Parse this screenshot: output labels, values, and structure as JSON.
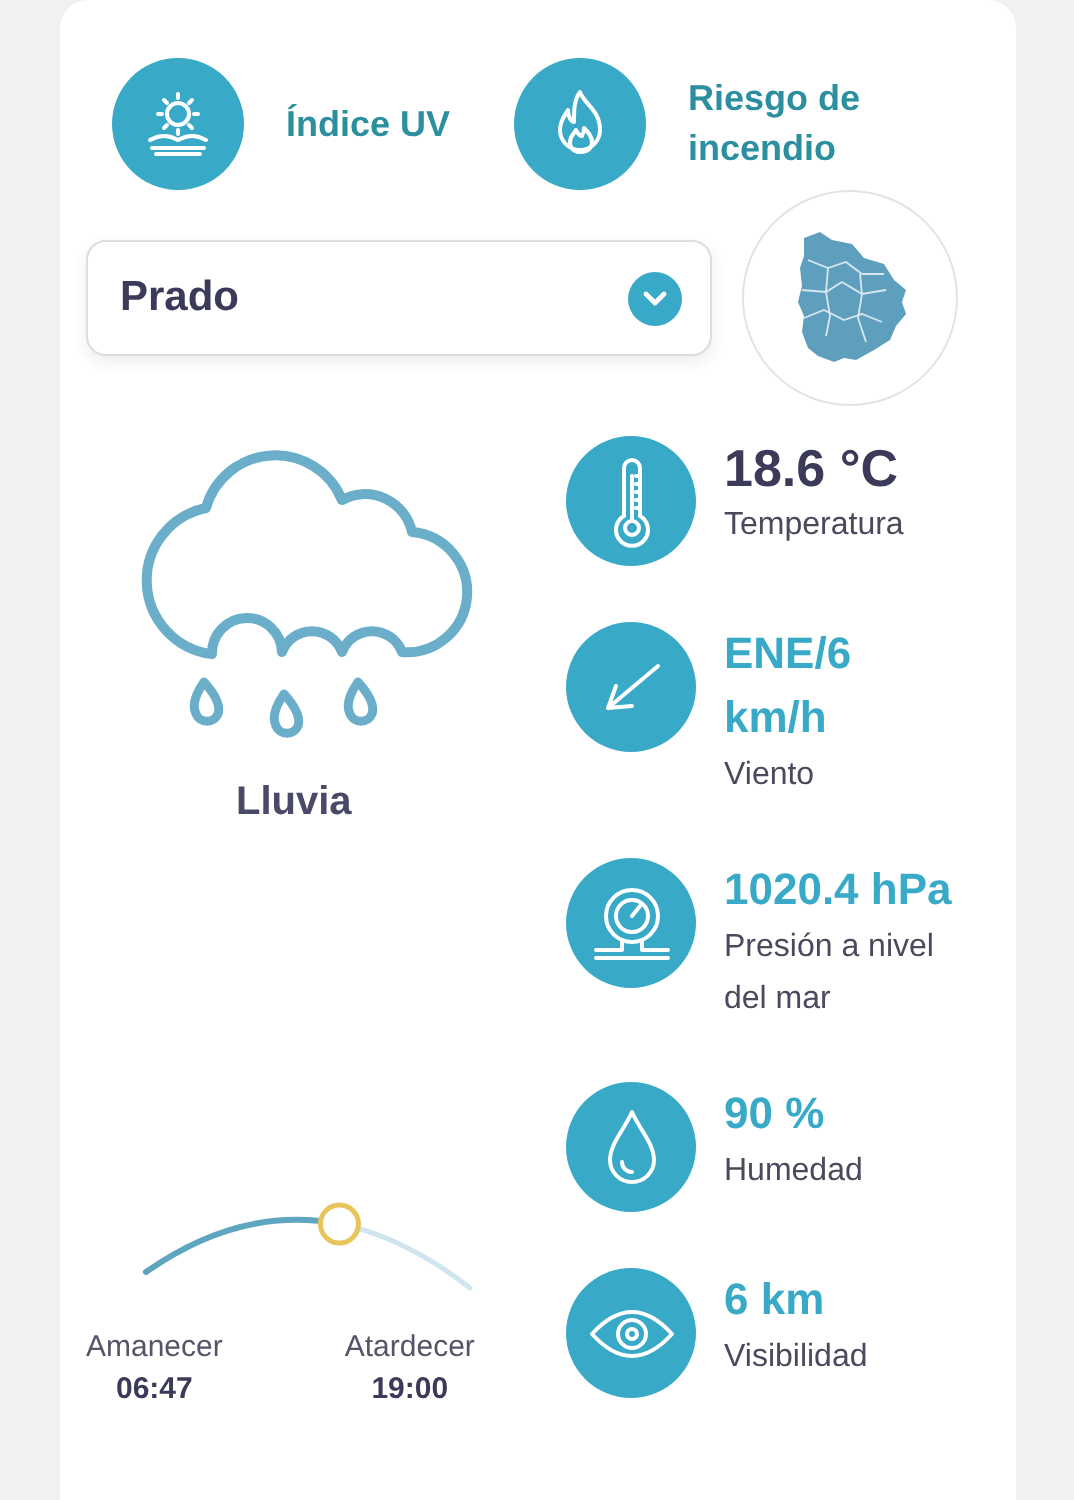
{
  "quick_links": [
    {
      "kind": "uv",
      "label": "Índice UV"
    },
    {
      "kind": "fire",
      "label": "Riesgo de incendio"
    }
  ],
  "location": {
    "value": "Prado"
  },
  "current": {
    "condition": "Lluvia"
  },
  "sun": {
    "level": 0.6,
    "sunrise_label": "Amanecer",
    "sunrise": "06:47",
    "sunset_label": "Atardecer",
    "sunset": "19:00"
  },
  "metrics": [
    {
      "kind": "temperature",
      "value": "18.6 °C",
      "label": "Temperatura",
      "color": "#3b3a58",
      "wrap": false
    },
    {
      "kind": "wind",
      "value": "ENE/6 km/h",
      "label": "Viento",
      "color": "#38a9c6",
      "wrap": true
    },
    {
      "kind": "pressure",
      "value": "1020.4 hPa",
      "label": "Presión a nivel del mar",
      "color": "#38a9c6",
      "wrap": false
    },
    {
      "kind": "humidity",
      "value": "90 %",
      "label": "Humedad",
      "color": "#38a9c6",
      "wrap": false
    },
    {
      "kind": "visibility",
      "value": "6 km",
      "label": "Visibilidad",
      "color": "#38a9c6",
      "wrap": false
    }
  ]
}
